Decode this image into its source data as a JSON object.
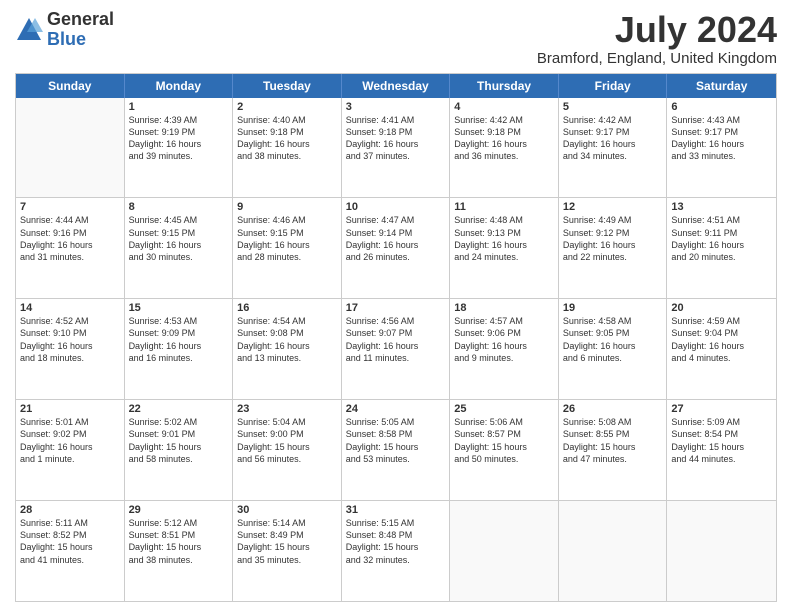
{
  "logo": {
    "general": "General",
    "blue": "Blue"
  },
  "title": "July 2024",
  "location": "Bramford, England, United Kingdom",
  "days_of_week": [
    "Sunday",
    "Monday",
    "Tuesday",
    "Wednesday",
    "Thursday",
    "Friday",
    "Saturday"
  ],
  "weeks": [
    [
      {
        "day": "",
        "text": ""
      },
      {
        "day": "1",
        "text": "Sunrise: 4:39 AM\nSunset: 9:19 PM\nDaylight: 16 hours\nand 39 minutes."
      },
      {
        "day": "2",
        "text": "Sunrise: 4:40 AM\nSunset: 9:18 PM\nDaylight: 16 hours\nand 38 minutes."
      },
      {
        "day": "3",
        "text": "Sunrise: 4:41 AM\nSunset: 9:18 PM\nDaylight: 16 hours\nand 37 minutes."
      },
      {
        "day": "4",
        "text": "Sunrise: 4:42 AM\nSunset: 9:18 PM\nDaylight: 16 hours\nand 36 minutes."
      },
      {
        "day": "5",
        "text": "Sunrise: 4:42 AM\nSunset: 9:17 PM\nDaylight: 16 hours\nand 34 minutes."
      },
      {
        "day": "6",
        "text": "Sunrise: 4:43 AM\nSunset: 9:17 PM\nDaylight: 16 hours\nand 33 minutes."
      }
    ],
    [
      {
        "day": "7",
        "text": "Sunrise: 4:44 AM\nSunset: 9:16 PM\nDaylight: 16 hours\nand 31 minutes."
      },
      {
        "day": "8",
        "text": "Sunrise: 4:45 AM\nSunset: 9:15 PM\nDaylight: 16 hours\nand 30 minutes."
      },
      {
        "day": "9",
        "text": "Sunrise: 4:46 AM\nSunset: 9:15 PM\nDaylight: 16 hours\nand 28 minutes."
      },
      {
        "day": "10",
        "text": "Sunrise: 4:47 AM\nSunset: 9:14 PM\nDaylight: 16 hours\nand 26 minutes."
      },
      {
        "day": "11",
        "text": "Sunrise: 4:48 AM\nSunset: 9:13 PM\nDaylight: 16 hours\nand 24 minutes."
      },
      {
        "day": "12",
        "text": "Sunrise: 4:49 AM\nSunset: 9:12 PM\nDaylight: 16 hours\nand 22 minutes."
      },
      {
        "day": "13",
        "text": "Sunrise: 4:51 AM\nSunset: 9:11 PM\nDaylight: 16 hours\nand 20 minutes."
      }
    ],
    [
      {
        "day": "14",
        "text": "Sunrise: 4:52 AM\nSunset: 9:10 PM\nDaylight: 16 hours\nand 18 minutes."
      },
      {
        "day": "15",
        "text": "Sunrise: 4:53 AM\nSunset: 9:09 PM\nDaylight: 16 hours\nand 16 minutes."
      },
      {
        "day": "16",
        "text": "Sunrise: 4:54 AM\nSunset: 9:08 PM\nDaylight: 16 hours\nand 13 minutes."
      },
      {
        "day": "17",
        "text": "Sunrise: 4:56 AM\nSunset: 9:07 PM\nDaylight: 16 hours\nand 11 minutes."
      },
      {
        "day": "18",
        "text": "Sunrise: 4:57 AM\nSunset: 9:06 PM\nDaylight: 16 hours\nand 9 minutes."
      },
      {
        "day": "19",
        "text": "Sunrise: 4:58 AM\nSunset: 9:05 PM\nDaylight: 16 hours\nand 6 minutes."
      },
      {
        "day": "20",
        "text": "Sunrise: 4:59 AM\nSunset: 9:04 PM\nDaylight: 16 hours\nand 4 minutes."
      }
    ],
    [
      {
        "day": "21",
        "text": "Sunrise: 5:01 AM\nSunset: 9:02 PM\nDaylight: 16 hours\nand 1 minute."
      },
      {
        "day": "22",
        "text": "Sunrise: 5:02 AM\nSunset: 9:01 PM\nDaylight: 15 hours\nand 58 minutes."
      },
      {
        "day": "23",
        "text": "Sunrise: 5:04 AM\nSunset: 9:00 PM\nDaylight: 15 hours\nand 56 minutes."
      },
      {
        "day": "24",
        "text": "Sunrise: 5:05 AM\nSunset: 8:58 PM\nDaylight: 15 hours\nand 53 minutes."
      },
      {
        "day": "25",
        "text": "Sunrise: 5:06 AM\nSunset: 8:57 PM\nDaylight: 15 hours\nand 50 minutes."
      },
      {
        "day": "26",
        "text": "Sunrise: 5:08 AM\nSunset: 8:55 PM\nDaylight: 15 hours\nand 47 minutes."
      },
      {
        "day": "27",
        "text": "Sunrise: 5:09 AM\nSunset: 8:54 PM\nDaylight: 15 hours\nand 44 minutes."
      }
    ],
    [
      {
        "day": "28",
        "text": "Sunrise: 5:11 AM\nSunset: 8:52 PM\nDaylight: 15 hours\nand 41 minutes."
      },
      {
        "day": "29",
        "text": "Sunrise: 5:12 AM\nSunset: 8:51 PM\nDaylight: 15 hours\nand 38 minutes."
      },
      {
        "day": "30",
        "text": "Sunrise: 5:14 AM\nSunset: 8:49 PM\nDaylight: 15 hours\nand 35 minutes."
      },
      {
        "day": "31",
        "text": "Sunrise: 5:15 AM\nSunset: 8:48 PM\nDaylight: 15 hours\nand 32 minutes."
      },
      {
        "day": "",
        "text": ""
      },
      {
        "day": "",
        "text": ""
      },
      {
        "day": "",
        "text": ""
      }
    ]
  ]
}
